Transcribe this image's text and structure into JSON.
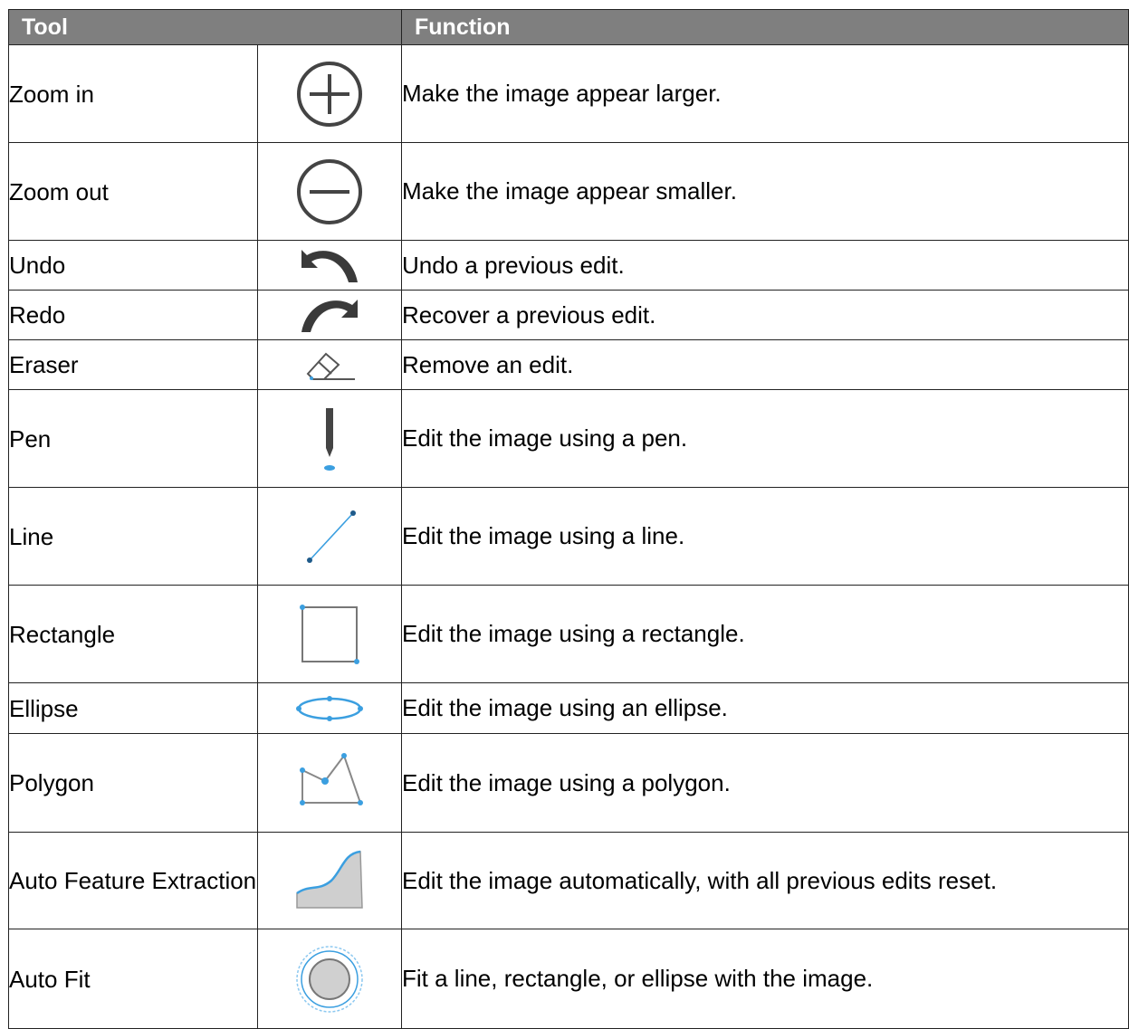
{
  "header": {
    "tool": "Tool",
    "function": "Function"
  },
  "rows": [
    {
      "name": "Zoom in",
      "icon": "zoom-in-icon",
      "function": "Make the image appear larger."
    },
    {
      "name": "Zoom out",
      "icon": "zoom-out-icon",
      "function": "Make the image appear smaller."
    },
    {
      "name": "Undo",
      "icon": "undo-icon",
      "function": "Undo a previous edit."
    },
    {
      "name": "Redo",
      "icon": "redo-icon",
      "function": "Recover a previous edit."
    },
    {
      "name": "Eraser",
      "icon": "eraser-icon",
      "function": "Remove an edit."
    },
    {
      "name": "Pen",
      "icon": "pen-icon",
      "function": "Edit the image using a pen."
    },
    {
      "name": "Line",
      "icon": "line-icon",
      "function": "Edit the image using a line."
    },
    {
      "name": "Rectangle",
      "icon": "rectangle-icon",
      "function": "Edit the image using a rectangle."
    },
    {
      "name": "Ellipse",
      "icon": "ellipse-icon",
      "function": "Edit the image using an ellipse."
    },
    {
      "name": "Polygon",
      "icon": "polygon-icon",
      "function": "Edit the image using a polygon."
    },
    {
      "name": "Auto Feature Extraction",
      "icon": "auto-feature-extraction-icon",
      "function": "Edit the image automatically, with all previous edits reset."
    },
    {
      "name": "Auto Fit",
      "icon": "auto-fit-icon",
      "function": "Fit a line, rectangle, or ellipse with the image."
    }
  ],
  "colors": {
    "header_bg": "#7f7f7f",
    "icon_dark": "#444444",
    "accent_blue": "#3b9fe0"
  }
}
